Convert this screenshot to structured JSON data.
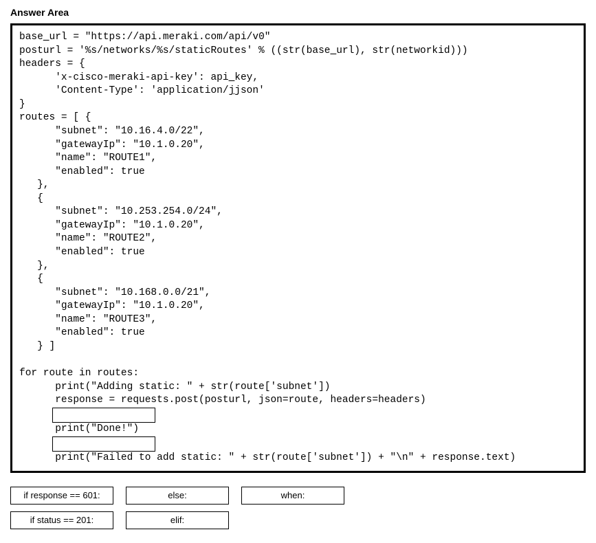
{
  "title": "Answer Area",
  "code": {
    "line1a": "base",
    "line1b": "url = \"https://api.meraki.com/api/v0\"",
    "line2a": "posturl = '%s/networks/%s/staticRoutes' % ((str(base",
    "line2b": "url), str(networkid)))",
    "line3": "headers = {",
    "line4a": "      'x-cisco-meraki-api-key': api",
    "line4b": "key,",
    "line5a": "      'Content-Type': 'application/",
    "line5b": "json'",
    "line6": "}",
    "line7": "routes = [ {",
    "line8": "      \"subnet\": \"10.16.4.0/22\",",
    "line9": "      \"gatewayIp\": \"10.1.0.20\",",
    "line10": "      \"name\": \"ROUTE1\",",
    "line11": "      \"enabled\": true",
    "line12": "   },",
    "line13": "   {",
    "line14": "      \"subnet\": \"10.253.254.0/24\",",
    "line15": "      \"gatewayIp\": \"10.1.0.20\",",
    "line16": "      \"name\": \"ROUTE2\",",
    "line17": "      \"enabled\": true",
    "line18": "   },",
    "line19": "   {",
    "line20": "      \"subnet\": \"10.168.0.0/21\",",
    "line21": "      \"gatewayIp\": \"10.1.0.20\",",
    "line22": "      \"name\": \"ROUTE3\",",
    "line23": "      \"enabled\": true",
    "line24": "   } ]",
    "line25": "",
    "line26": "for route in routes:",
    "line27": "      print(\"Adding static: \" + str(route['subnet'])",
    "line28": "      response = requests.post(posturl, json=route, headers=headers)",
    "line30": "      print(\"Done!\")",
    "line32": "      print(\"Failed to add static: \" + str(route['subnet']) + \"\\n\" + response.text)"
  },
  "options": {
    "opt1": "if response == 601:",
    "opt2": "else:",
    "opt3": "when:",
    "opt4": "if status == 201:",
    "opt5": "elif:"
  }
}
